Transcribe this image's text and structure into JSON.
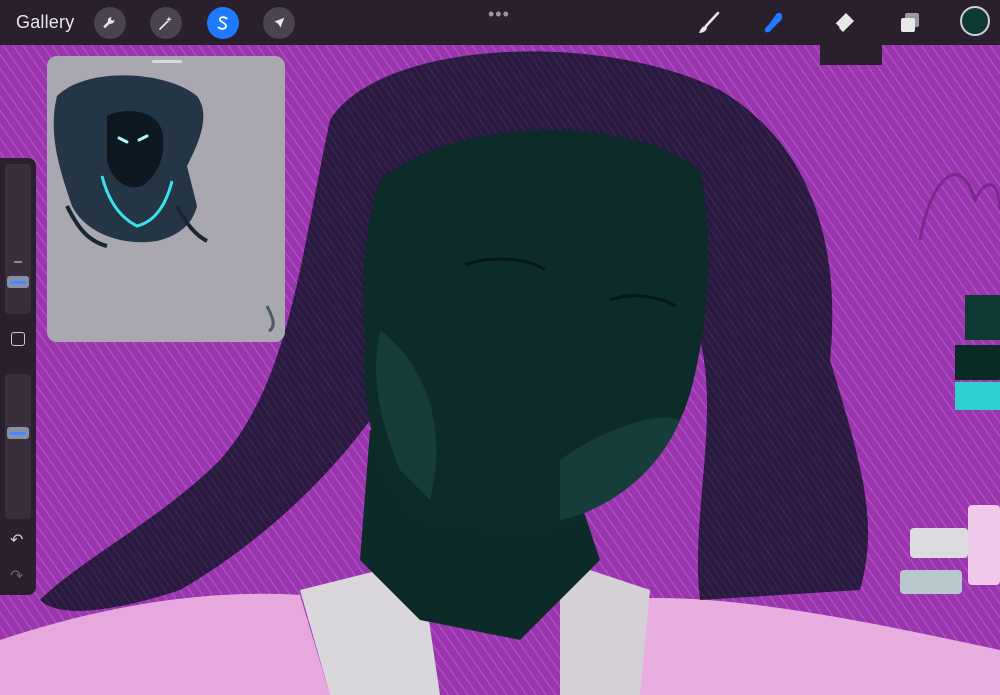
{
  "topbar": {
    "gallery_label": "Gallery",
    "tools_left": [
      {
        "name": "actions",
        "icon": "wrench-icon"
      },
      {
        "name": "adjustments",
        "icon": "magic-wand-icon"
      },
      {
        "name": "selection",
        "icon": "selection-s-icon",
        "active": true
      },
      {
        "name": "transform",
        "icon": "arrow-cursor-icon"
      }
    ],
    "more_label": "•••",
    "tools_right": [
      {
        "name": "brush",
        "icon": "brush-icon"
      },
      {
        "name": "smudge",
        "icon": "smudge-icon",
        "active": true
      },
      {
        "name": "eraser",
        "icon": "eraser-icon"
      },
      {
        "name": "layers",
        "icon": "layers-icon"
      }
    ],
    "current_color": "#0f3a34"
  },
  "sidebar": {
    "brush_size_slider": "brush-size",
    "opacity_slider": "opacity",
    "undo_label": "↶",
    "redo_label": "↷"
  },
  "colors": {
    "accent": "#1e7bff",
    "background": "#8a2f9c",
    "toolbar": "#2a1f2c"
  }
}
